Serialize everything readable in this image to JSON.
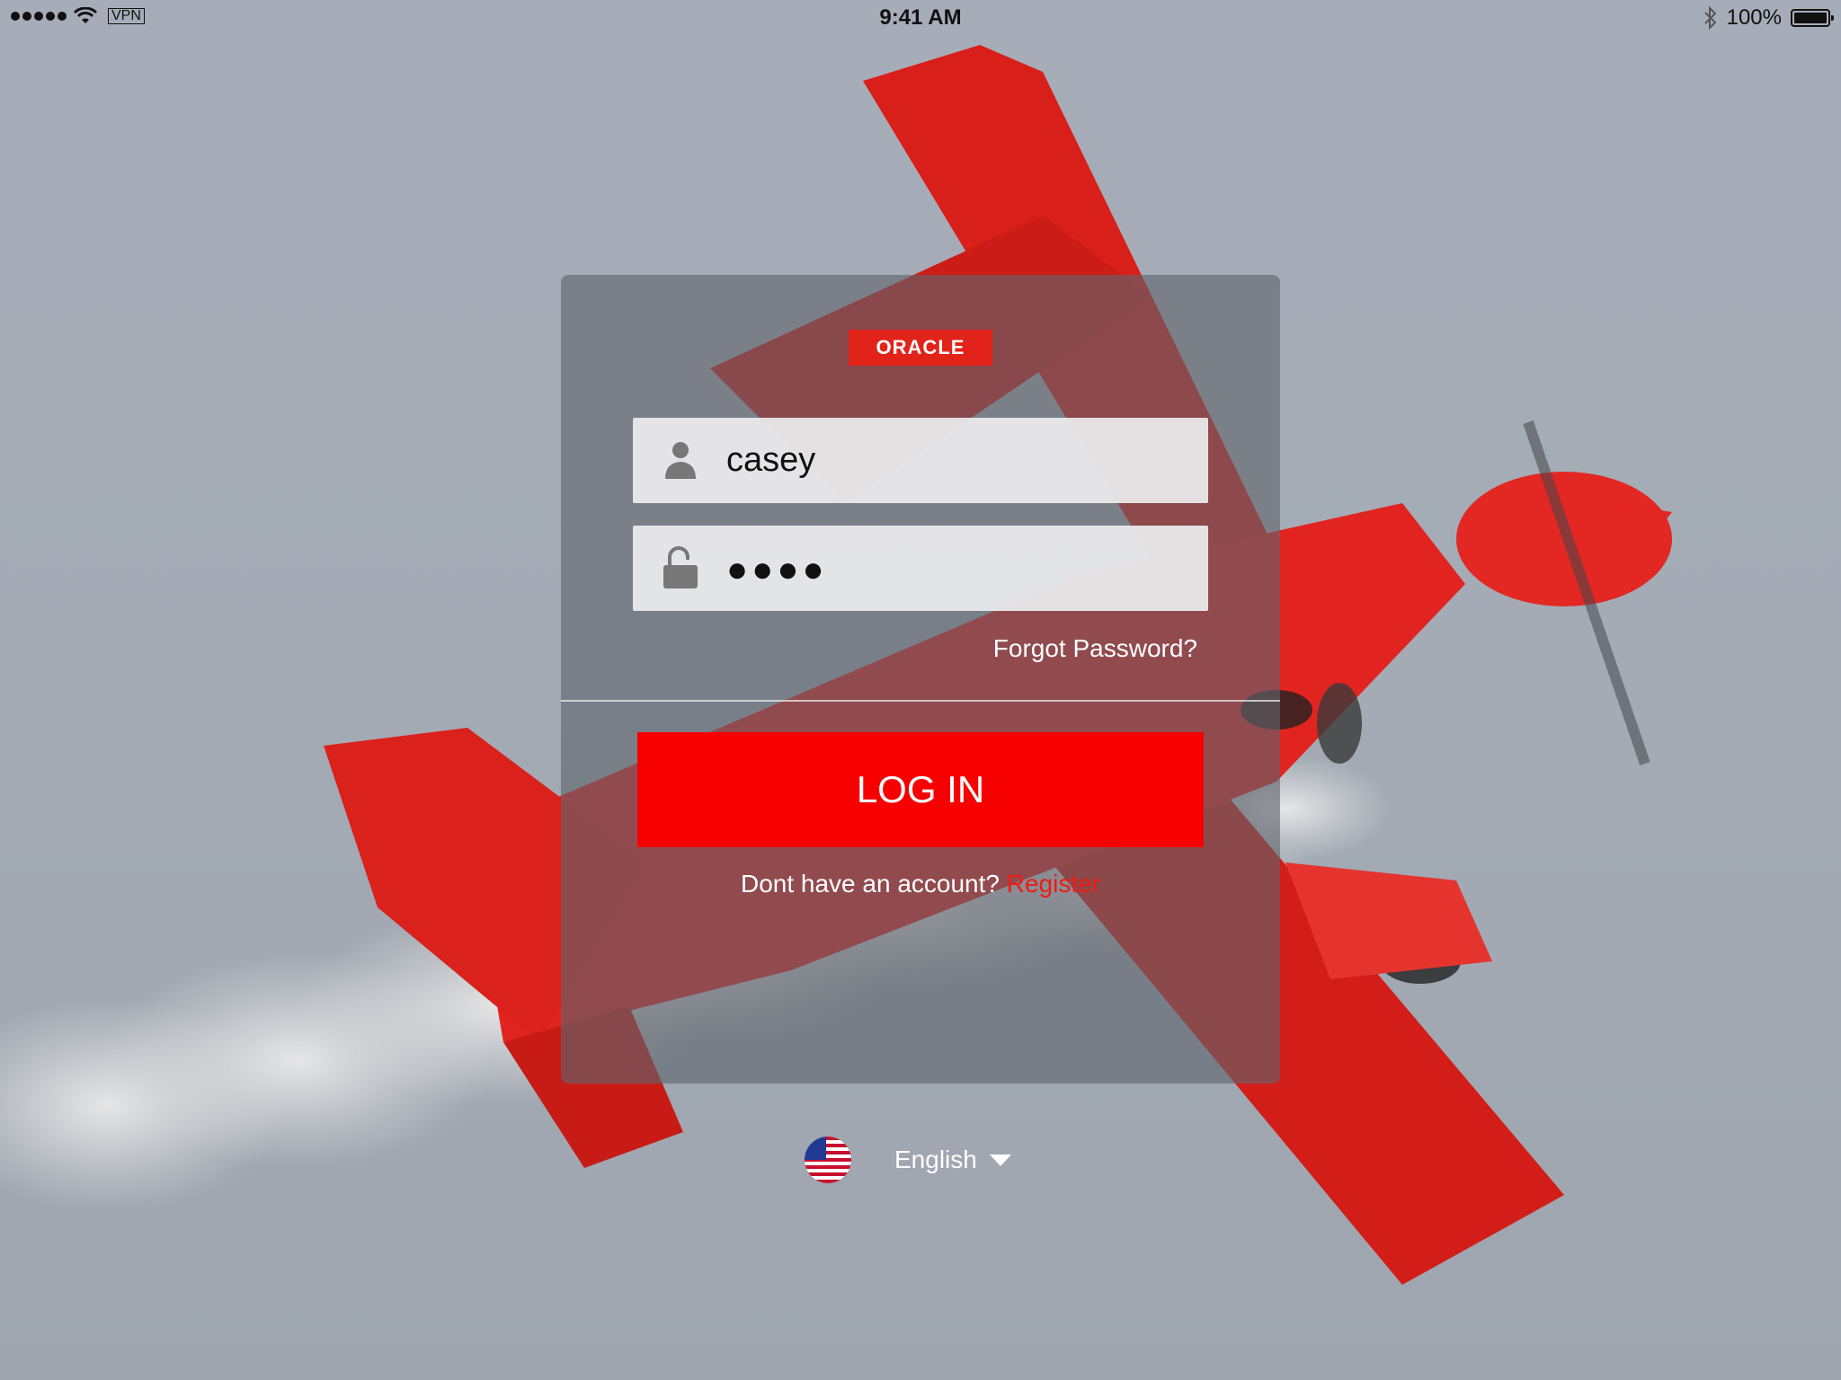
{
  "status_bar": {
    "vpn_label": "VPN",
    "time": "9:41 AM",
    "battery_text": "100%"
  },
  "brand": {
    "logo_text": "ORACLE",
    "accent_color": "#f60000"
  },
  "login": {
    "username_value": "casey",
    "password_mask": "●●●●",
    "forgot_password": "Forgot Password?",
    "login_button": "LOG IN",
    "no_account_text": "Dont have an account?",
    "register_link": "Register"
  },
  "language": {
    "selected": "English",
    "flag": "us-flag-icon"
  },
  "icons": {
    "username": "user-icon",
    "password": "unlock-icon",
    "wifi": "wifi-icon",
    "bluetooth": "bluetooth-icon",
    "battery": "battery-icon",
    "dropdown": "caret-down-icon"
  }
}
